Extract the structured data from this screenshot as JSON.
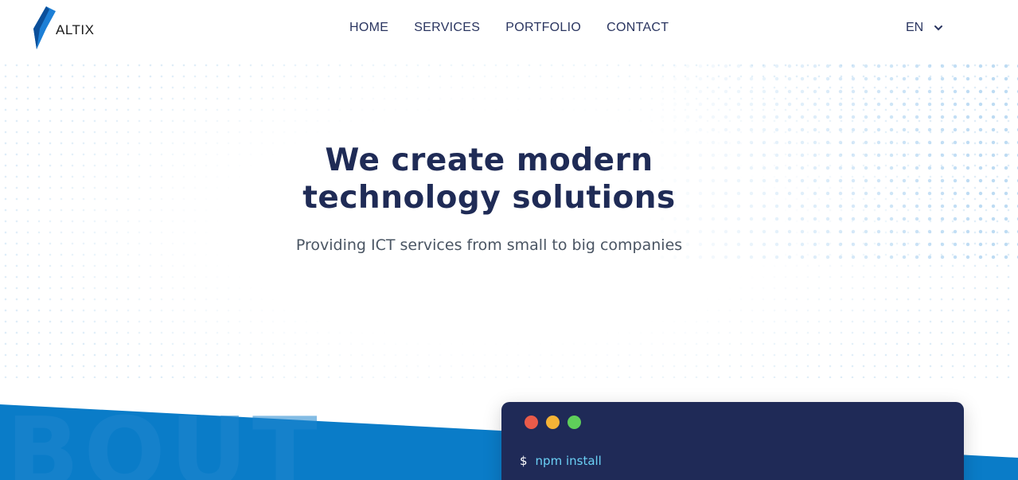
{
  "brand": {
    "name": "ALTIX"
  },
  "nav": {
    "items": [
      {
        "label": "HOME"
      },
      {
        "label": "SERVICES"
      },
      {
        "label": "PORTFOLIO"
      },
      {
        "label": "CONTACT"
      }
    ]
  },
  "language": {
    "selected": "EN",
    "icon": "chevron-down-icon"
  },
  "hero": {
    "title_line1": "We create modern",
    "title_line2": "technology solutions",
    "subtitle": "Providing ICT services from small to big companies"
  },
  "about_band": {
    "watermark": "BOUT"
  },
  "terminal": {
    "dots": [
      {
        "color": "#e95b4a",
        "icon": "red-window-dot"
      },
      {
        "color": "#f5b336",
        "icon": "yellow-window-dot"
      },
      {
        "color": "#5fcf5a",
        "icon": "green-window-dot"
      }
    ],
    "prompt": "$",
    "command": "npm install"
  },
  "colors": {
    "primary": "#0a7cc8",
    "navy": "#1f2a57",
    "text_dark": "#1f2b56",
    "accent_cyan": "#6bd0f5"
  }
}
